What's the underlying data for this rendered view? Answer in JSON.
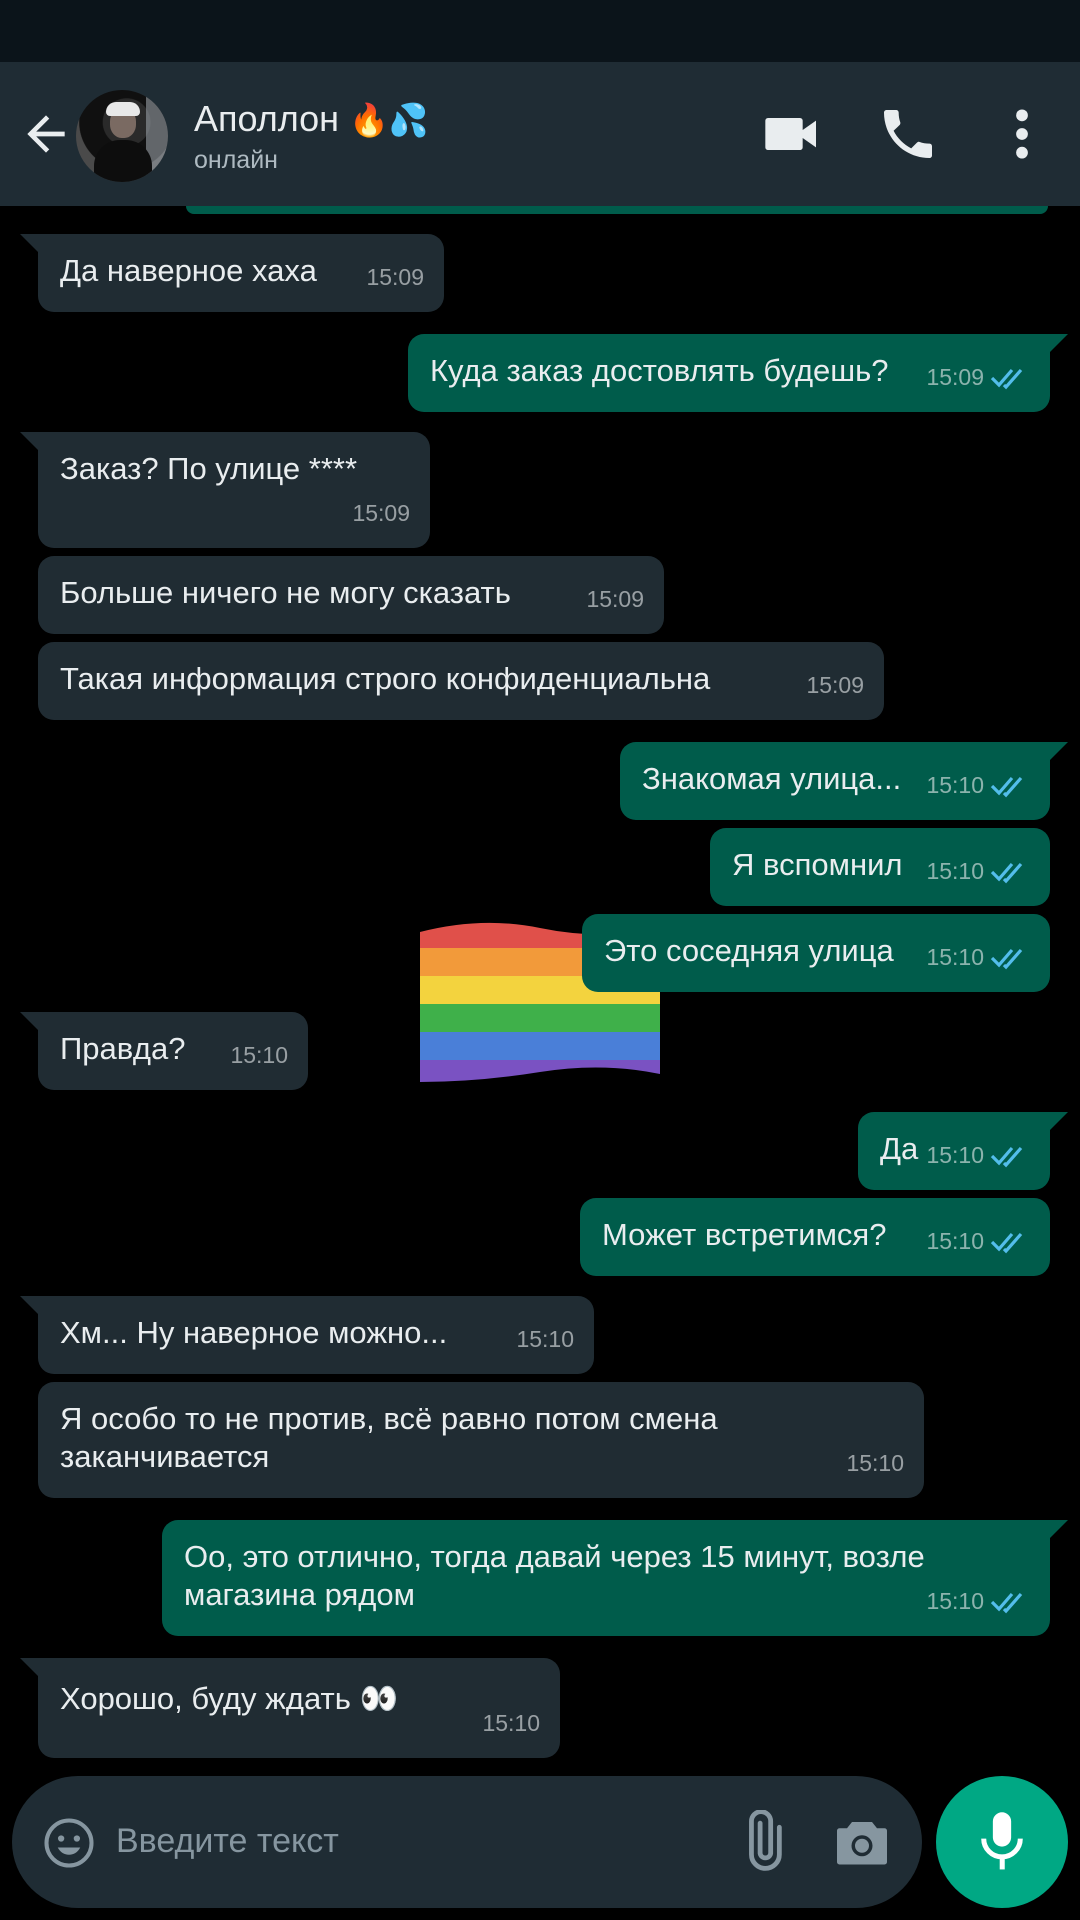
{
  "header": {
    "contact_name": "Аполлон",
    "name_emoji": "🔥💦",
    "status": "онлайн"
  },
  "composer": {
    "placeholder": "Введите текст"
  },
  "messages": [
    {
      "dir": "in",
      "text": "Да наверное хаха",
      "time": "15:09"
    },
    {
      "dir": "out",
      "text": "Куда заказ достовлять будешь?",
      "time": "15:09"
    },
    {
      "dir": "in",
      "text": "Заказ? По улице ****",
      "time": "15:09"
    },
    {
      "dir": "in",
      "text": "Больше ничего не могу сказать",
      "time": "15:09"
    },
    {
      "dir": "in",
      "text": "Такая информация строго  конфиденциальна",
      "time": "15:09"
    },
    {
      "dir": "out",
      "text": "Знакомая улица...",
      "time": "15:10"
    },
    {
      "dir": "out",
      "text": "Я вспомнил",
      "time": "15:10"
    },
    {
      "dir": "out",
      "text": "Это соседняя улица",
      "time": "15:10"
    },
    {
      "dir": "in",
      "text": "Правда?",
      "time": "15:10"
    },
    {
      "dir": "out",
      "text": "Да",
      "time": "15:10"
    },
    {
      "dir": "out",
      "text": "Может встретимся?",
      "time": "15:10"
    },
    {
      "dir": "in",
      "text": "Хм... Ну наверное можно...",
      "time": "15:10"
    },
    {
      "dir": "in",
      "text": "Я особо то не против, всё равно потом смена заканчивается",
      "time": "15:10"
    },
    {
      "dir": "out",
      "text": "Оо, это отлично, тогда давай через 15 минут, возле магазина рядом",
      "time": "15:10"
    },
    {
      "dir": "in",
      "text": "Хорошо, буду ждать 👀",
      "time": "15:10"
    }
  ],
  "colors": {
    "incoming_bubble": "#202c33",
    "outgoing_bubble": "#005c4b",
    "read_ticks": "#53bdeb",
    "mic_button": "#00a884"
  },
  "icons": [
    "back-arrow-icon",
    "video-call-icon",
    "voice-call-icon",
    "more-options-icon",
    "emoji-icon",
    "attach-icon",
    "camera-icon",
    "mic-icon",
    "read-ticks-icon",
    "rainbow-flag-sticker"
  ]
}
